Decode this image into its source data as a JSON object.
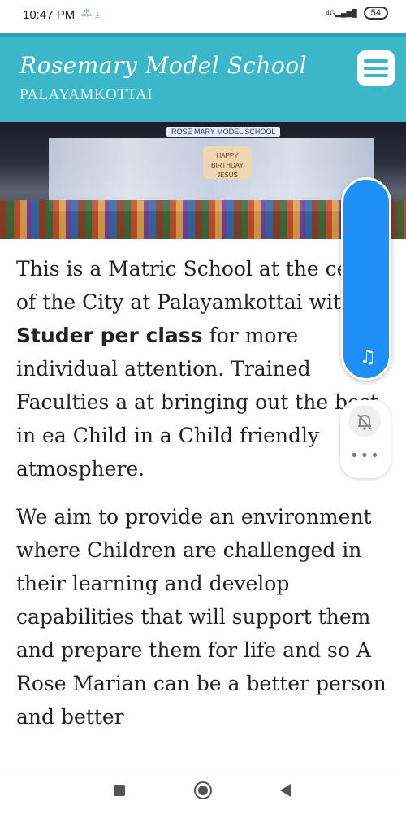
{
  "status_bar": {
    "time": "10:47 PM",
    "notification_icons": "⁂ ⤓",
    "network": "4G",
    "battery": "54"
  },
  "header": {
    "title": "Rosemary Model School",
    "subtitle": "PALAYAMKOTTAI",
    "menu_icon": "hamburger-menu-icon"
  },
  "banner": {
    "sign_text": "ROSE MARY MODEL SCHOOL",
    "stage_text": "HAPPY BIRTHDAY JESUS"
  },
  "content": {
    "p1_pre": "This is a Matric School at the centre of the City at Palayamkottai with ",
    "p1_bold": "25 Studer per class",
    "p1_post": " for more individual attention. Trained Faculties a at bringing out the best in ea Child in a Child friendly atmosphere.",
    "p2": "We aim to provide an environment where  Children are challenged in their learning and develop capabilities that will support them and prepare them for life and so A Rose Marian can be a better person and better"
  },
  "floating_widget": {
    "music_icon": "music-note-icon",
    "mute_icon": "bell-off-icon",
    "more_icon": "more-dots-icon",
    "accent": "#1e90f5"
  },
  "colors": {
    "header_bg": "#3cb6c9",
    "header_text": "#ffffff"
  }
}
